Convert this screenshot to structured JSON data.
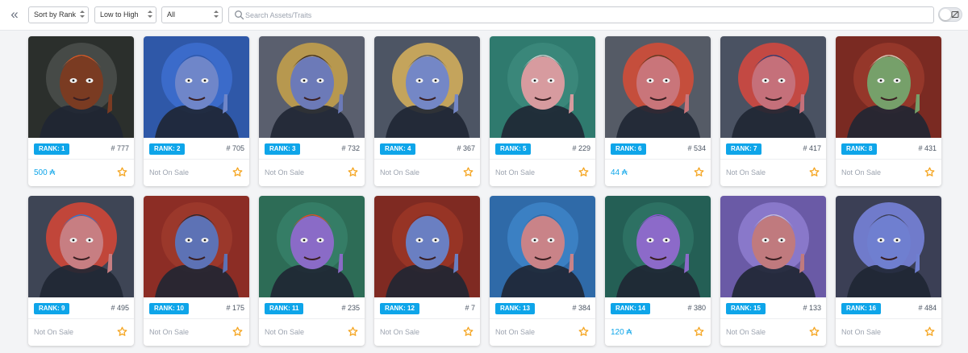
{
  "toolbar": {
    "sort": "Sort by Rank",
    "order": "Low to High",
    "filter": "All",
    "search_placeholder": "Search Assets/Traits"
  },
  "colors": {
    "accent": "#0ea5e9",
    "star": "#f5a623"
  },
  "cards": [
    {
      "rank": "RANK: 1",
      "number": "# 777",
      "sale": "500 ₳",
      "on_sale": true,
      "bg": "#2b2f2c",
      "face": "#7a3b22",
      "halo": "#4b4f4c",
      "top": "#e2571f"
    },
    {
      "rank": "RANK: 2",
      "number": "# 705",
      "sale": "Not On Sale",
      "on_sale": false,
      "bg": "#2f58a8",
      "face": "#6f86c9",
      "halo": "#3d6fd0",
      "top": "#2f58a8"
    },
    {
      "rank": "RANK: 3",
      "number": "# 732",
      "sale": "Not On Sale",
      "on_sale": false,
      "bg": "#5a5f6e",
      "face": "#6c7ab8",
      "halo": "#c8a24a",
      "top": "#3b2a1e"
    },
    {
      "rank": "RANK: 4",
      "number": "# 367",
      "sale": "Not On Sale",
      "on_sale": false,
      "bg": "#4d5564",
      "face": "#7487c6",
      "halo": "#d9b35a",
      "top": "#4d5564"
    },
    {
      "rank": "RANK: 5",
      "number": "# 229",
      "sale": "Not On Sale",
      "on_sale": false,
      "bg": "#2f7a6e",
      "face": "#d79b9f",
      "halo": "#3c8a7c",
      "top": "#cfd2d0"
    },
    {
      "rank": "RANK: 6",
      "number": "# 534",
      "sale": "44 ₳",
      "on_sale": true,
      "bg": "#555b66",
      "face": "#c9757a",
      "halo": "#d94c35",
      "top": "#5a3a22"
    },
    {
      "rank": "RANK: 7",
      "number": "# 417",
      "sale": "Not On Sale",
      "on_sale": false,
      "bg": "#4a5262",
      "face": "#c5707a",
      "halo": "#d8483e",
      "top": "#2a3f78"
    },
    {
      "rank": "RANK: 8",
      "number": "# 431",
      "sale": "Not On Sale",
      "on_sale": false,
      "bg": "#7a2a22",
      "face": "#76a06a",
      "halo": "#9a3a2c",
      "top": "#d9d2c1"
    },
    {
      "rank": "RANK: 9",
      "number": "# 495",
      "sale": "Not On Sale",
      "on_sale": false,
      "bg": "#3e4555",
      "face": "#c77e82",
      "halo": "#d84636",
      "top": "#2b7ad9"
    },
    {
      "rank": "RANK: 10",
      "number": "# 175",
      "sale": "Not On Sale",
      "on_sale": false,
      "bg": "#8c2d25",
      "face": "#5d72b5",
      "halo": "#9d3b2d",
      "top": "#222831"
    },
    {
      "rank": "RANK: 11",
      "number": "# 235",
      "sale": "Not On Sale",
      "on_sale": false,
      "bg": "#2d6c56",
      "face": "#8a6bc7",
      "halo": "#378068",
      "top": "#e84a22"
    },
    {
      "rank": "RANK: 12",
      "number": "# 7",
      "sale": "Not On Sale",
      "on_sale": false,
      "bg": "#7f2a22",
      "face": "#6a7fc2",
      "halo": "#9b3626",
      "top": "#7f2a22"
    },
    {
      "rank": "RANK: 13",
      "number": "# 384",
      "sale": "Not On Sale",
      "on_sale": false,
      "bg": "#2f6aa8",
      "face": "#c98388",
      "halo": "#3d84c8",
      "top": "#2f6aa8"
    },
    {
      "rank": "RANK: 14",
      "number": "# 380",
      "sale": "120 ₳",
      "on_sale": true,
      "bg": "#245f55",
      "face": "#8c6ac9",
      "halo": "#2f7466",
      "top": "#9a4de0"
    },
    {
      "rank": "RANK: 15",
      "number": "# 133",
      "sale": "Not On Sale",
      "on_sale": false,
      "bg": "#6a5aa6",
      "face": "#c07a7e",
      "halo": "#8e7ed0",
      "top": "#c8c0d8"
    },
    {
      "rank": "RANK: 16",
      "number": "# 484",
      "sale": "Not On Sale",
      "on_sale": false,
      "bg": "#3b3f55",
      "face": "#6f7fd0",
      "halo": "#7a86e0",
      "top": "#3b3f55"
    }
  ]
}
